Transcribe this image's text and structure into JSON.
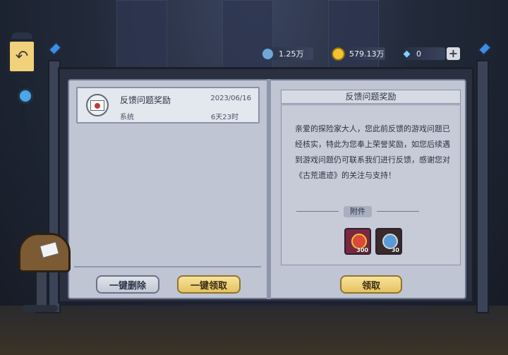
{
  "resources": [
    {
      "icon": "blue-coin-icon",
      "value": "1.25万",
      "color": "#6fa8d8"
    },
    {
      "icon": "gold-coin-icon",
      "value": "579.13万",
      "color": "#f2c233"
    },
    {
      "icon": "diamond-icon",
      "value": "0",
      "color": "#7fd3f5"
    }
  ],
  "add_label": "+",
  "back_icon": "↶",
  "mail_list": [
    {
      "title": "反馈问题奖励",
      "date": "2023/06/16",
      "sender": "系统",
      "expires": "6天23时"
    }
  ],
  "left_buttons": {
    "delete_all": "一键删除",
    "claim_all": "一键领取"
  },
  "detail": {
    "title": "反馈问题奖励",
    "body": "亲爱的探险家大人，您此前反馈的游戏问题已经核实，特此为您奉上荣誉奖励，如您后续遇到游戏问题仍可联系我们进行反馈，感谢您对《古荒遗迹》的关注与支持！",
    "attachments_label": "附件",
    "attachments": [
      {
        "icon": "honor-medal-icon",
        "qty": "300",
        "bg": "#7a2840",
        "color": "#d94a3a"
      },
      {
        "icon": "blue-coin-icon",
        "qty": "30",
        "bg": "#3a2a28",
        "color": "#5c9ad6"
      }
    ],
    "claim_label": "领取"
  },
  "colors": {
    "accent_gold": "#e4c260",
    "page": "#bfc5d3"
  }
}
